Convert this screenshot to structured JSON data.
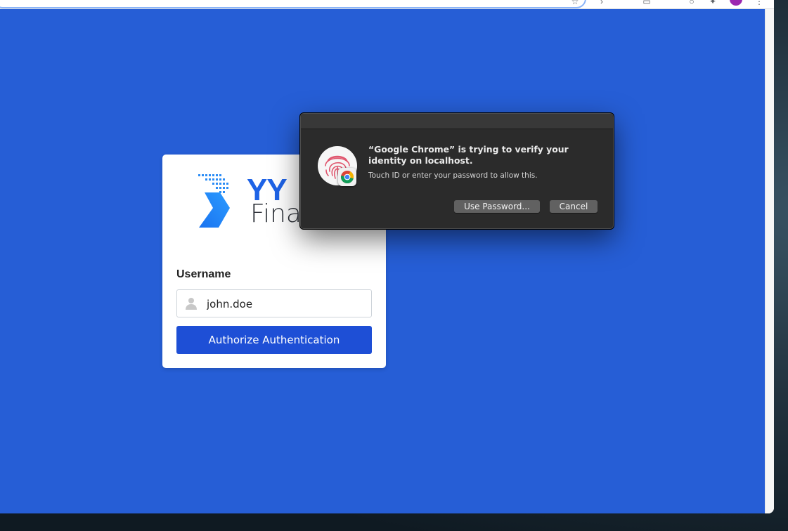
{
  "login": {
    "logo": {
      "brand_top": "YY",
      "brand_bottom": "Fina"
    },
    "username_label": "Username",
    "username_value": "john.doe",
    "authorize_label": "Authorize Authentication"
  },
  "touchid_dialog": {
    "title": "“Google Chrome” is trying to verify your identity on localhost.",
    "message": "Touch ID or enter your password to allow this.",
    "use_password_label": "Use Password...",
    "cancel_label": "Cancel"
  },
  "colors": {
    "page_background": "#265ed6",
    "primary_button": "#1e4fd6",
    "dialog_background": "#2b2b2b",
    "fingerprint": "#e0566e"
  },
  "icons": {
    "username": "user-icon",
    "fingerprint": "fingerprint-icon",
    "badge": "chrome-icon"
  }
}
